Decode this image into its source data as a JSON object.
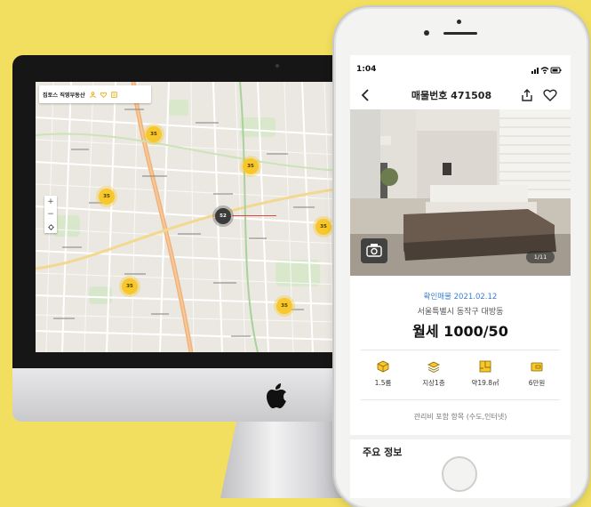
{
  "map_app": {
    "brand_name": "집토스 직영부동산",
    "header_icons": [
      "person-icon",
      "heart-icon",
      "list-icon"
    ],
    "zoom_in": "+",
    "zoom_out": "−",
    "clusters": [
      "35",
      "35",
      "35",
      "35",
      "35",
      "35",
      "52"
    ]
  },
  "phone": {
    "status_time": "1:04",
    "nav": {
      "title": "매물번호 471508"
    },
    "photo_pager": "1/11",
    "listing": {
      "confirmed": "확인매물 2021.02.12",
      "address": "서울특별시 동작구 대방동",
      "price": "월세 1000/50"
    },
    "specs": [
      {
        "icon": "cube-icon",
        "label": "1.5룸"
      },
      {
        "icon": "layers-icon",
        "label": "지상1층"
      },
      {
        "icon": "floorplan-icon",
        "label": "약19.8㎡"
      },
      {
        "icon": "card-icon",
        "label": "6만원"
      }
    ],
    "maintenance_note": "관리비 포함 항목 (수도,인터넷)",
    "section_title": "주요 정보"
  },
  "colors": {
    "background": "#f2df5f",
    "accent": "#f7c72c",
    "link": "#3b7fd6"
  }
}
